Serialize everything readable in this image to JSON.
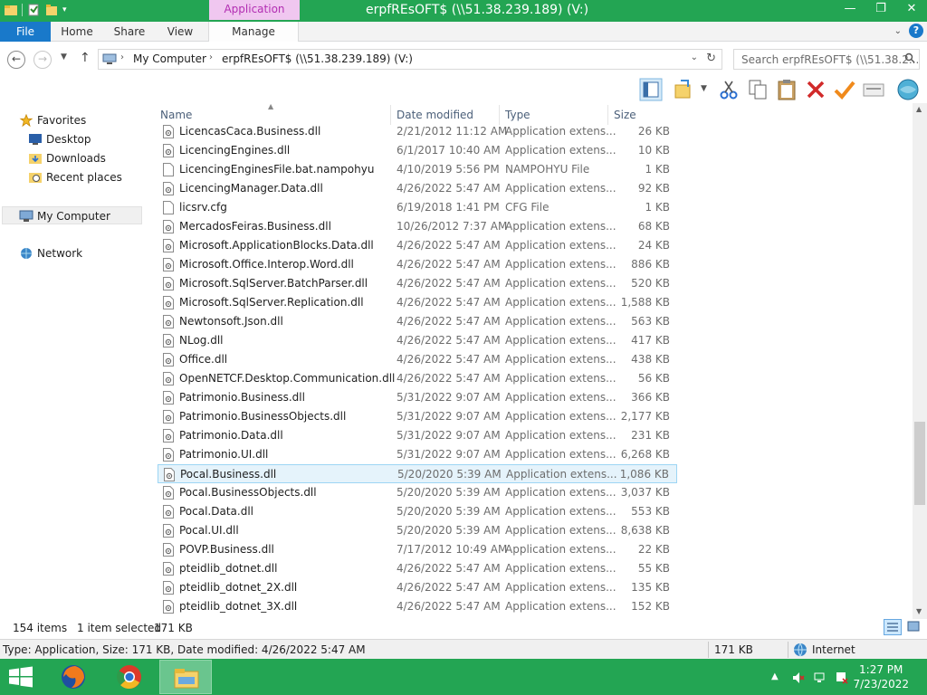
{
  "window": {
    "title": "erpfREsOFT$ (\\\\51.38.239.189) (V:)",
    "context_tab": "Application Tools",
    "minimize": "—",
    "maximize": "❐",
    "close": "✕"
  },
  "ribbon": {
    "tabs": [
      "File",
      "Home",
      "Share",
      "View",
      "Manage"
    ]
  },
  "address": {
    "segments": [
      "My Computer",
      "erpfREsOFT$ (\\\\51.38.239.189) (V:)"
    ],
    "search_placeholder": "Search erpfREsOFT$ (\\\\51.38.2..."
  },
  "navpane": {
    "favorites": "Favorites",
    "desktop": "Desktop",
    "downloads": "Downloads",
    "recent": "Recent places",
    "computer": "My Computer",
    "network": "Network"
  },
  "columns": {
    "name": "Name",
    "date": "Date modified",
    "type": "Type",
    "size": "Size"
  },
  "files": [
    {
      "name": "LicencasCaca.Business.dll",
      "date": "2/21/2012 11:12 AM",
      "type": "Application extens...",
      "size": "26 KB",
      "icon": "dll"
    },
    {
      "name": "LicencingEngines.dll",
      "date": "6/1/2017 10:40 AM",
      "type": "Application extens...",
      "size": "10 KB",
      "icon": "dll"
    },
    {
      "name": "LicencingEnginesFile.bat.nampohyu",
      "date": "4/10/2019 5:56 PM",
      "type": "NAMPOHYU File",
      "size": "1 KB",
      "icon": "blank"
    },
    {
      "name": "LicencingManager.Data.dll",
      "date": "4/26/2022 5:47 AM",
      "type": "Application extens...",
      "size": "92 KB",
      "icon": "dll"
    },
    {
      "name": "licsrv.cfg",
      "date": "6/19/2018 1:41 PM",
      "type": "CFG File",
      "size": "1 KB",
      "icon": "blank"
    },
    {
      "name": "MercadosFeiras.Business.dll",
      "date": "10/26/2012 7:37 AM",
      "type": "Application extens...",
      "size": "68 KB",
      "icon": "dll"
    },
    {
      "name": "Microsoft.ApplicationBlocks.Data.dll",
      "date": "4/26/2022 5:47 AM",
      "type": "Application extens...",
      "size": "24 KB",
      "icon": "dll"
    },
    {
      "name": "Microsoft.Office.Interop.Word.dll",
      "date": "4/26/2022 5:47 AM",
      "type": "Application extens...",
      "size": "886 KB",
      "icon": "dll"
    },
    {
      "name": "Microsoft.SqlServer.BatchParser.dll",
      "date": "4/26/2022 5:47 AM",
      "type": "Application extens...",
      "size": "520 KB",
      "icon": "dll"
    },
    {
      "name": "Microsoft.SqlServer.Replication.dll",
      "date": "4/26/2022 5:47 AM",
      "type": "Application extens...",
      "size": "1,588 KB",
      "icon": "dll"
    },
    {
      "name": "Newtonsoft.Json.dll",
      "date": "4/26/2022 5:47 AM",
      "type": "Application extens...",
      "size": "563 KB",
      "icon": "dll"
    },
    {
      "name": "NLog.dll",
      "date": "4/26/2022 5:47 AM",
      "type": "Application extens...",
      "size": "417 KB",
      "icon": "dll"
    },
    {
      "name": "Office.dll",
      "date": "4/26/2022 5:47 AM",
      "type": "Application extens...",
      "size": "438 KB",
      "icon": "dll"
    },
    {
      "name": "OpenNETCF.Desktop.Communication.dll",
      "date": "4/26/2022 5:47 AM",
      "type": "Application extens...",
      "size": "56 KB",
      "icon": "dll"
    },
    {
      "name": "Patrimonio.Business.dll",
      "date": "5/31/2022 9:07 AM",
      "type": "Application extens...",
      "size": "366 KB",
      "icon": "dll"
    },
    {
      "name": "Patrimonio.BusinessObjects.dll",
      "date": "5/31/2022 9:07 AM",
      "type": "Application extens...",
      "size": "2,177 KB",
      "icon": "dll"
    },
    {
      "name": "Patrimonio.Data.dll",
      "date": "5/31/2022 9:07 AM",
      "type": "Application extens...",
      "size": "231 KB",
      "icon": "dll"
    },
    {
      "name": "Patrimonio.UI.dll",
      "date": "5/31/2022 9:07 AM",
      "type": "Application extens...",
      "size": "6,268 KB",
      "icon": "dll"
    },
    {
      "name": "Pocal.Business.dll",
      "date": "5/20/2020 5:39 AM",
      "type": "Application extens...",
      "size": "1,086 KB",
      "icon": "dll",
      "selected": true
    },
    {
      "name": "Pocal.BusinessObjects.dll",
      "date": "5/20/2020 5:39 AM",
      "type": "Application extens...",
      "size": "3,037 KB",
      "icon": "dll"
    },
    {
      "name": "Pocal.Data.dll",
      "date": "5/20/2020 5:39 AM",
      "type": "Application extens...",
      "size": "553 KB",
      "icon": "dll"
    },
    {
      "name": "Pocal.UI.dll",
      "date": "5/20/2020 5:39 AM",
      "type": "Application extens...",
      "size": "8,638 KB",
      "icon": "dll"
    },
    {
      "name": "POVP.Business.dll",
      "date": "7/17/2012 10:49 AM",
      "type": "Application extens...",
      "size": "22 KB",
      "icon": "dll"
    },
    {
      "name": "pteidlib_dotnet.dll",
      "date": "4/26/2022 5:47 AM",
      "type": "Application extens...",
      "size": "55 KB",
      "icon": "dll"
    },
    {
      "name": "pteidlib_dotnet_2X.dll",
      "date": "4/26/2022 5:47 AM",
      "type": "Application extens...",
      "size": "135 KB",
      "icon": "dll"
    },
    {
      "name": "pteidlib_dotnet_3X.dll",
      "date": "4/26/2022 5:47 AM",
      "type": "Application extens...",
      "size": "152 KB",
      "icon": "dll"
    }
  ],
  "status": {
    "items": "154 items",
    "selected": "1 item selected",
    "selected_size": "171 KB",
    "details": "Type: Application, Size: 171 KB, Date modified: 4/26/2022 5:47 AM",
    "size": "171 KB",
    "zone": "Internet"
  },
  "taskbar": {
    "time": "1:27 PM",
    "date": "7/23/2022",
    "tray_expand": "▲"
  },
  "colors": {
    "accent_green": "#23a553",
    "file_tab_blue": "#1979ca",
    "app_tools_pink": "#f0c7f0"
  }
}
